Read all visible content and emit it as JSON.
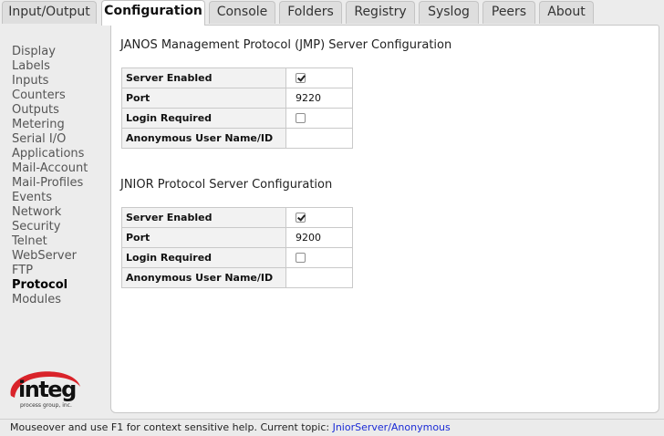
{
  "tabs": [
    {
      "label": "Input/Output",
      "active": false
    },
    {
      "label": "Configuration",
      "active": true
    },
    {
      "label": "Console",
      "active": false
    },
    {
      "label": "Folders",
      "active": false
    },
    {
      "label": "Registry",
      "active": false
    },
    {
      "label": "Syslog",
      "active": false
    },
    {
      "label": "Peers",
      "active": false
    },
    {
      "label": "About",
      "active": false
    }
  ],
  "sidebar": {
    "items": [
      {
        "label": "Display"
      },
      {
        "label": "Labels"
      },
      {
        "label": "Inputs"
      },
      {
        "label": "Counters"
      },
      {
        "label": "Outputs"
      },
      {
        "label": "Metering"
      },
      {
        "label": "Serial I/O"
      },
      {
        "label": "Applications"
      },
      {
        "label": "Mail-Account"
      },
      {
        "label": "Mail-Profiles"
      },
      {
        "label": "Events"
      },
      {
        "label": "Network"
      },
      {
        "label": "Security"
      },
      {
        "label": "Telnet"
      },
      {
        "label": "WebServer"
      },
      {
        "label": "FTP"
      },
      {
        "label": "Protocol",
        "active": true
      },
      {
        "label": "Modules"
      }
    ]
  },
  "logo": {
    "text": "integ",
    "subtext": "process group, inc."
  },
  "jmp": {
    "title": "JANOS Management Protocol (JMP) Server Configuration",
    "server_enabled_label": "Server Enabled",
    "server_enabled": true,
    "port_label": "Port",
    "port": "9220",
    "login_required_label": "Login Required",
    "login_required": false,
    "anon_label": "Anonymous User Name/ID",
    "anon": ""
  },
  "jnior": {
    "title": "JNIOR Protocol Server Configuration",
    "server_enabled_label": "Server Enabled",
    "server_enabled": true,
    "port_label": "Port",
    "port": "9200",
    "login_required_label": "Login Required",
    "login_required": false,
    "anon_label": "Anonymous User Name/ID",
    "anon": ""
  },
  "status": {
    "text": "Mouseover and use F1 for context sensitive help. Current topic: ",
    "topic": "JniorServer/Anonymous"
  },
  "colors": {
    "logo_accent": "#d9232a",
    "topic_link": "#1b2bd6"
  }
}
